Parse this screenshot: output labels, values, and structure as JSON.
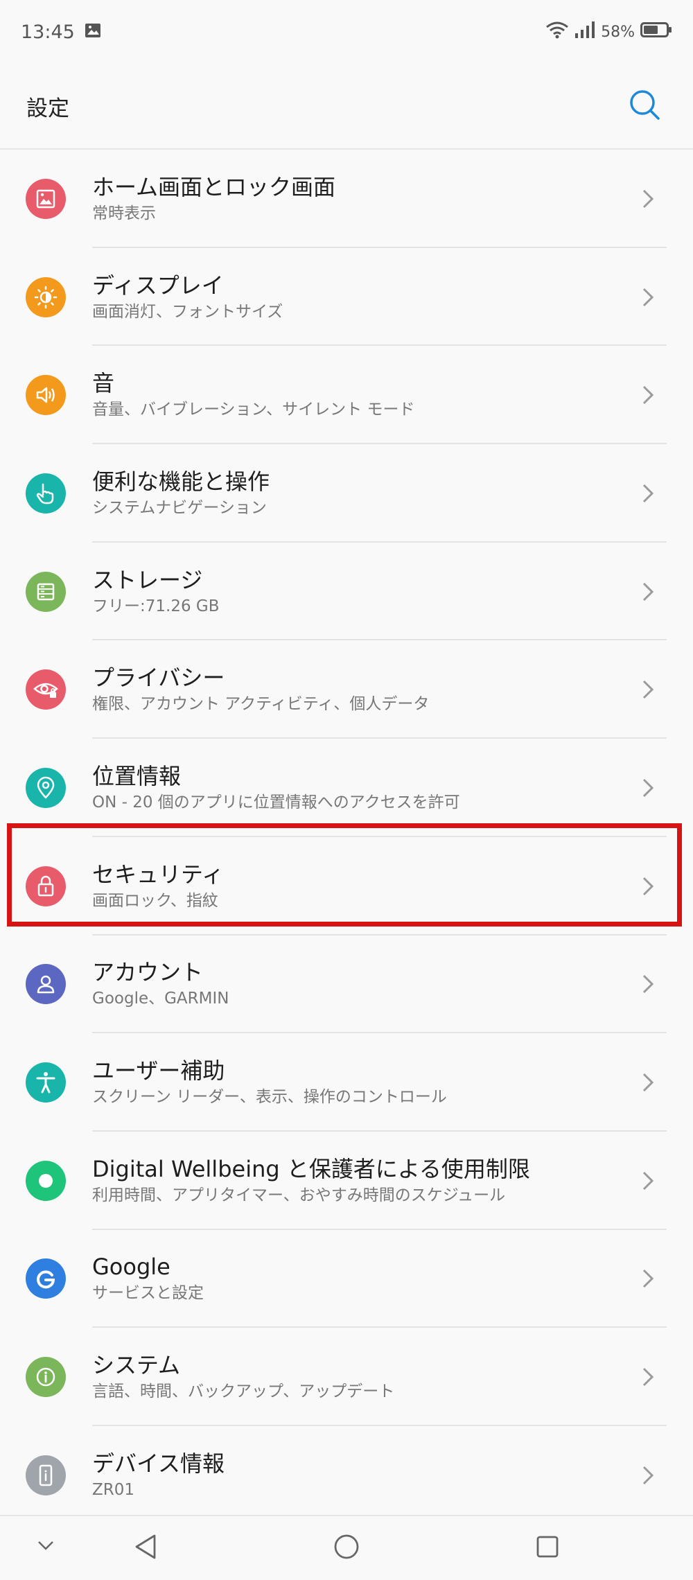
{
  "status_bar": {
    "time": "13:45",
    "battery": "58%"
  },
  "header": {
    "title": "設定"
  },
  "settings": [
    {
      "title": "ホーム画面とロック画面",
      "subtitle": "常時表示",
      "color": "#e85b6a",
      "icon": "home-lock-screen-icon"
    },
    {
      "title": "ディスプレイ",
      "subtitle": "画面消灯、フォントサイズ",
      "color": "#f39a1d",
      "icon": "display-brightness-icon"
    },
    {
      "title": "音",
      "subtitle": "音量、バイブレーション、サイレント モード",
      "color": "#f39a1d",
      "icon": "speaker-icon"
    },
    {
      "title": "便利な機能と操作",
      "subtitle": "システムナビゲーション",
      "color": "#19b5aa",
      "icon": "hand-gesture-icon"
    },
    {
      "title": "ストレージ",
      "subtitle": "フリー:71.26 GB",
      "color": "#7cb65b",
      "icon": "storage-icon"
    },
    {
      "title": "プライバシー",
      "subtitle": "権限、アカウント アクティビティ、個人データ",
      "color": "#e85b6a",
      "icon": "privacy-eye-icon"
    },
    {
      "title": "位置情報",
      "subtitle": "ON - 20 個のアプリに位置情報へのアクセスを許可",
      "color": "#19b5aa",
      "icon": "location-pin-icon"
    },
    {
      "title": "セキュリティ",
      "subtitle": "画面ロック、指紋",
      "color": "#e85b6a",
      "icon": "lock-icon"
    },
    {
      "title": "アカウント",
      "subtitle": "Google、GARMIN",
      "color": "#5b67c0",
      "icon": "account-person-icon"
    },
    {
      "title": "ユーザー補助",
      "subtitle": "スクリーン リーダー、表示、操作のコントロール",
      "color": "#19b5aa",
      "icon": "accessibility-icon"
    },
    {
      "title": "Digital Wellbeing と保護者による使用制限",
      "subtitle": "利用時間、アプリタイマー、おやすみ時間のスケジュール",
      "color": "#1ec47a",
      "icon": "wellbeing-icon"
    },
    {
      "title": "Google",
      "subtitle": "サービスと設定",
      "color": "#2f7fe0",
      "icon": "google-icon"
    },
    {
      "title": "システム",
      "subtitle": "言語、時間、バックアップ、アップデート",
      "color": "#7cb65b",
      "icon": "info-icon"
    },
    {
      "title": "デバイス情報",
      "subtitle": "ZR01",
      "color": "#a0a4ab",
      "icon": "device-phone-icon"
    }
  ],
  "colors": {
    "accent": "#1e88d8",
    "highlight": "#d61414"
  }
}
